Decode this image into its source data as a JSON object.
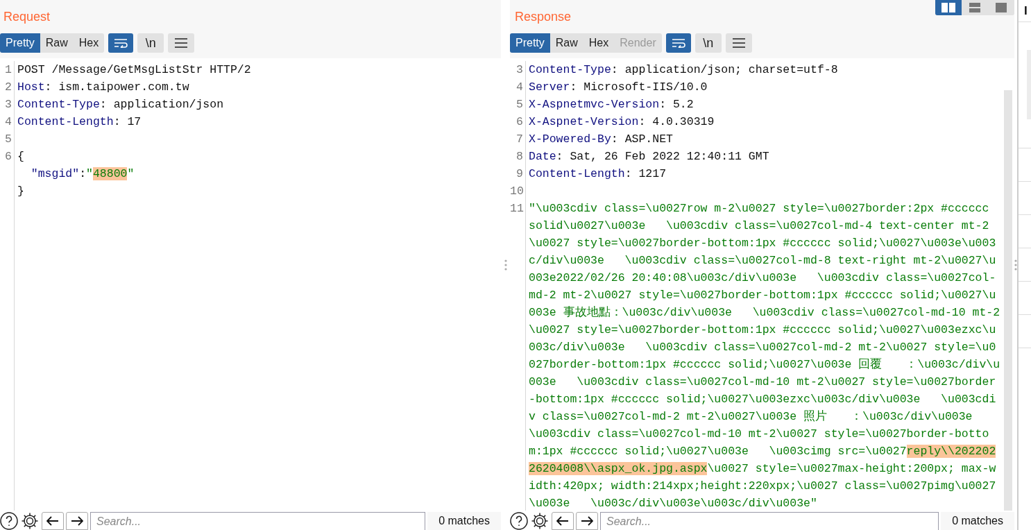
{
  "request": {
    "title": "Request",
    "view_tabs": [
      {
        "label": "Pretty",
        "selected": true,
        "disabled": false
      },
      {
        "label": "Raw",
        "selected": false,
        "disabled": false
      },
      {
        "label": "Hex",
        "selected": false,
        "disabled": false
      }
    ],
    "wrap_selected": true,
    "newline_label": "\\n",
    "lines": [
      {
        "number": "1",
        "segments": [
          {
            "kind": "plain",
            "text": "POST /Message/GetMsgListStr HTTP/2"
          }
        ]
      },
      {
        "number": "2",
        "segments": [
          {
            "kind": "key",
            "text": "Host"
          },
          {
            "kind": "plain",
            "text": ": ism.taipower.com.tw"
          }
        ]
      },
      {
        "number": "3",
        "segments": [
          {
            "kind": "key",
            "text": "Content-Type"
          },
          {
            "kind": "plain",
            "text": ": application/json"
          }
        ]
      },
      {
        "number": "4",
        "segments": [
          {
            "kind": "key",
            "text": "Content-Length"
          },
          {
            "kind": "plain",
            "text": ": 17"
          }
        ]
      },
      {
        "number": "5"
      },
      {
        "number": "6",
        "segments": [
          {
            "kind": "plain",
            "text": "{"
          }
        ]
      },
      {
        "segments": [
          {
            "kind": "key",
            "text": "  \"msgid\""
          },
          {
            "kind": "plain",
            "text": ":"
          },
          {
            "kind": "string",
            "text": "\""
          },
          {
            "kind": "highlight",
            "text": "48800"
          },
          {
            "kind": "string",
            "text": "\""
          }
        ]
      },
      {
        "segments": [
          {
            "kind": "plain",
            "text": "}"
          }
        ]
      }
    ],
    "search": {
      "placeholder": "Search...",
      "matches": "0 matches"
    }
  },
  "response": {
    "title": "Response",
    "view_tabs": [
      {
        "label": "Pretty",
        "selected": true,
        "disabled": false
      },
      {
        "label": "Raw",
        "selected": false,
        "disabled": false
      },
      {
        "label": "Hex",
        "selected": false,
        "disabled": false
      },
      {
        "label": "Render",
        "selected": false,
        "disabled": true
      }
    ],
    "wrap_selected": true,
    "newline_label": "\\n",
    "lines": [
      {
        "number": "3",
        "segments": [
          {
            "kind": "key",
            "text": "Content-Type"
          },
          {
            "kind": "plain",
            "text": ": application/json; charset=utf-8"
          }
        ]
      },
      {
        "number": "4",
        "segments": [
          {
            "kind": "key",
            "text": "Server"
          },
          {
            "kind": "plain",
            "text": ": Microsoft-IIS/10.0"
          }
        ]
      },
      {
        "number": "5",
        "segments": [
          {
            "kind": "key",
            "text": "X-Aspnetmvc-Version"
          },
          {
            "kind": "plain",
            "text": ": 5.2"
          }
        ]
      },
      {
        "number": "6",
        "segments": [
          {
            "kind": "key",
            "text": "X-Aspnet-Version"
          },
          {
            "kind": "plain",
            "text": ": 4.0.30319"
          }
        ]
      },
      {
        "number": "7",
        "segments": [
          {
            "kind": "key",
            "text": "X-Powered-By"
          },
          {
            "kind": "plain",
            "text": ": ASP.NET"
          }
        ]
      },
      {
        "number": "8",
        "segments": [
          {
            "kind": "key",
            "text": "Date"
          },
          {
            "kind": "plain",
            "text": ": Sat, 26 Feb 2022 12:40:11 GMT"
          }
        ]
      },
      {
        "number": "9",
        "segments": [
          {
            "kind": "key",
            "text": "Content-Length"
          },
          {
            "kind": "plain",
            "text": ": 1217"
          }
        ]
      },
      {
        "number": "10"
      },
      {
        "number": "11",
        "segments": [
          {
            "kind": "string",
            "text": "\"\\u003cdiv class=\\u0027row m-2\\u0027 style=\\u0027border:2px #cccccc solid\\u0027\\u003e   \\u003cdiv class=\\u0027col-md-4 text-center mt-2\\u0027 style=\\u0027border-bottom:1px #cccccc solid;\\u0027\\u003e\\u003c/div\\u003e   \\u003cdiv class=\\u0027col-md-8 text-right mt-2\\u0027\\u003e2022/02/26 20:40:08\\u003c/div\\u003e   \\u003cdiv class=\\u0027col-md-2 mt-2\\u0027 style=\\u0027border-bottom:1px #cccccc solid;\\u0027\\u003e 事故地點：\\u003c/div\\u003e   \\u003cdiv class=\\u0027col-md-10 mt-2\\u0027 style=\\u0027border-bottom:1px #cccccc solid;\\u0027\\u003ezxc\\u003c/div\\u003e   \\u003cdiv class=\\u0027col-md-2 mt-2\\u0027 style=\\u0027border-bottom:1px #cccccc solid;\\u0027\\u003e 回覆　　：\\u003c/div\\u003e   \\u003cdiv class=\\u0027col-md-10 mt-2\\u0027 style=\\u0027border-bottom:1px #cccccc solid;\\u0027\\u003ezxc\\u003c/div\\u003e   \\u003cdiv class=\\u0027col-md-2 mt-2\\u0027\\u003e 照片　　：\\u003c/div\\u003e   \\u003cdiv class=\\u0027col-md-10 mt-2\\u0027 style=\\u0027border-bottom:1px #cccccc solid;\\u0027\\u003e   \\u003cimg src=\\u0027"
          },
          {
            "kind": "highlight",
            "text": "reply\\\\20220226204008\\\\aspx_ok.jpg.aspx"
          },
          {
            "kind": "string",
            "text": "\\u0027 style=\\u0027max-height:200px; max-width:420px; width:214xpx;height:220xpx;\\u0027 class=\\u0027pimg\\u0027 \\u003e   \\u003c/div\\u003e\\u003c/div\\u003e\""
          }
        ]
      }
    ],
    "search": {
      "placeholder": "Search...",
      "matches": "0 matches"
    }
  },
  "layout_modes": [
    {
      "kind": "columns",
      "selected": true
    },
    {
      "kind": "rows",
      "selected": false
    },
    {
      "kind": "single",
      "selected": false
    }
  ],
  "inspector": {
    "title": "I"
  }
}
